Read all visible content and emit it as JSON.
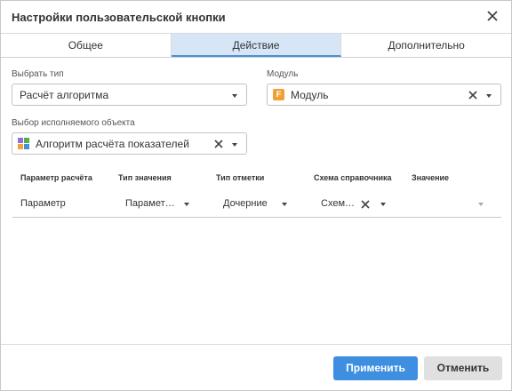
{
  "dialog": {
    "title": "Настройки пользовательской кнопки"
  },
  "tabs": [
    {
      "label": "Общее",
      "active": false
    },
    {
      "label": "Действие",
      "active": true
    },
    {
      "label": "Дополнительно",
      "active": false
    }
  ],
  "form": {
    "type_label": "Выбрать тип",
    "type_value": "Расчёт алгоритма",
    "module_label": "Модуль",
    "module_value": "Модуль",
    "module_icon": "module-icon",
    "object_label": "Выбор исполняемого объекта",
    "object_value": "Алгоритм расчёта показателей",
    "object_icon": "algorithm-icon"
  },
  "grid": {
    "headers": [
      "Параметр расчёта",
      "Тип значения",
      "Тип отметки",
      "Схема справочника",
      "Значение"
    ],
    "row": {
      "param": "Параметр",
      "value_type": "Парамет…",
      "mark_type": "Дочерние",
      "schema": "Схем…",
      "value": ""
    }
  },
  "buttons": {
    "apply": "Применить",
    "cancel": "Отменить"
  },
  "colors": {
    "accent": "#3f8fe0",
    "active_tab": "#d6e6f7",
    "module_icon": "#f0a036"
  }
}
